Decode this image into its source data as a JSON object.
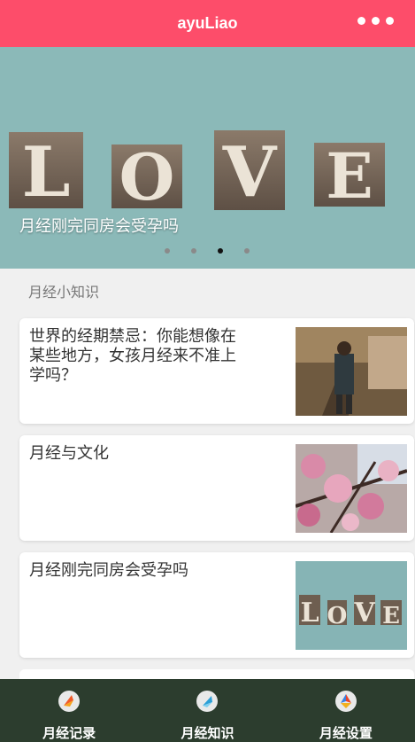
{
  "navbar": {
    "title": "ayuLiao",
    "more_icon": "more-dots-icon"
  },
  "banner": {
    "caption": "月经刚完同房会受孕吗",
    "image_text": "LOVE",
    "slide_count": 4,
    "active_slide": 3
  },
  "section": {
    "title": "月经小知识"
  },
  "articles": [
    {
      "title": "世界的经期禁忌：你能想像在某些地方，女孩月经来不准上学吗？"
    },
    {
      "title": "月经与文化"
    },
    {
      "title": "月经刚完同房会受孕吗"
    }
  ],
  "tabs": [
    {
      "label": "月经记录",
      "icon": "record-icon"
    },
    {
      "label": "月经知识",
      "icon": "knowledge-icon"
    },
    {
      "label": "月经设置",
      "icon": "settings-icon"
    }
  ],
  "colors": {
    "navbar": "#fd4d6a",
    "tabbar": "#2c3d2e",
    "background": "#f0f0f0"
  }
}
